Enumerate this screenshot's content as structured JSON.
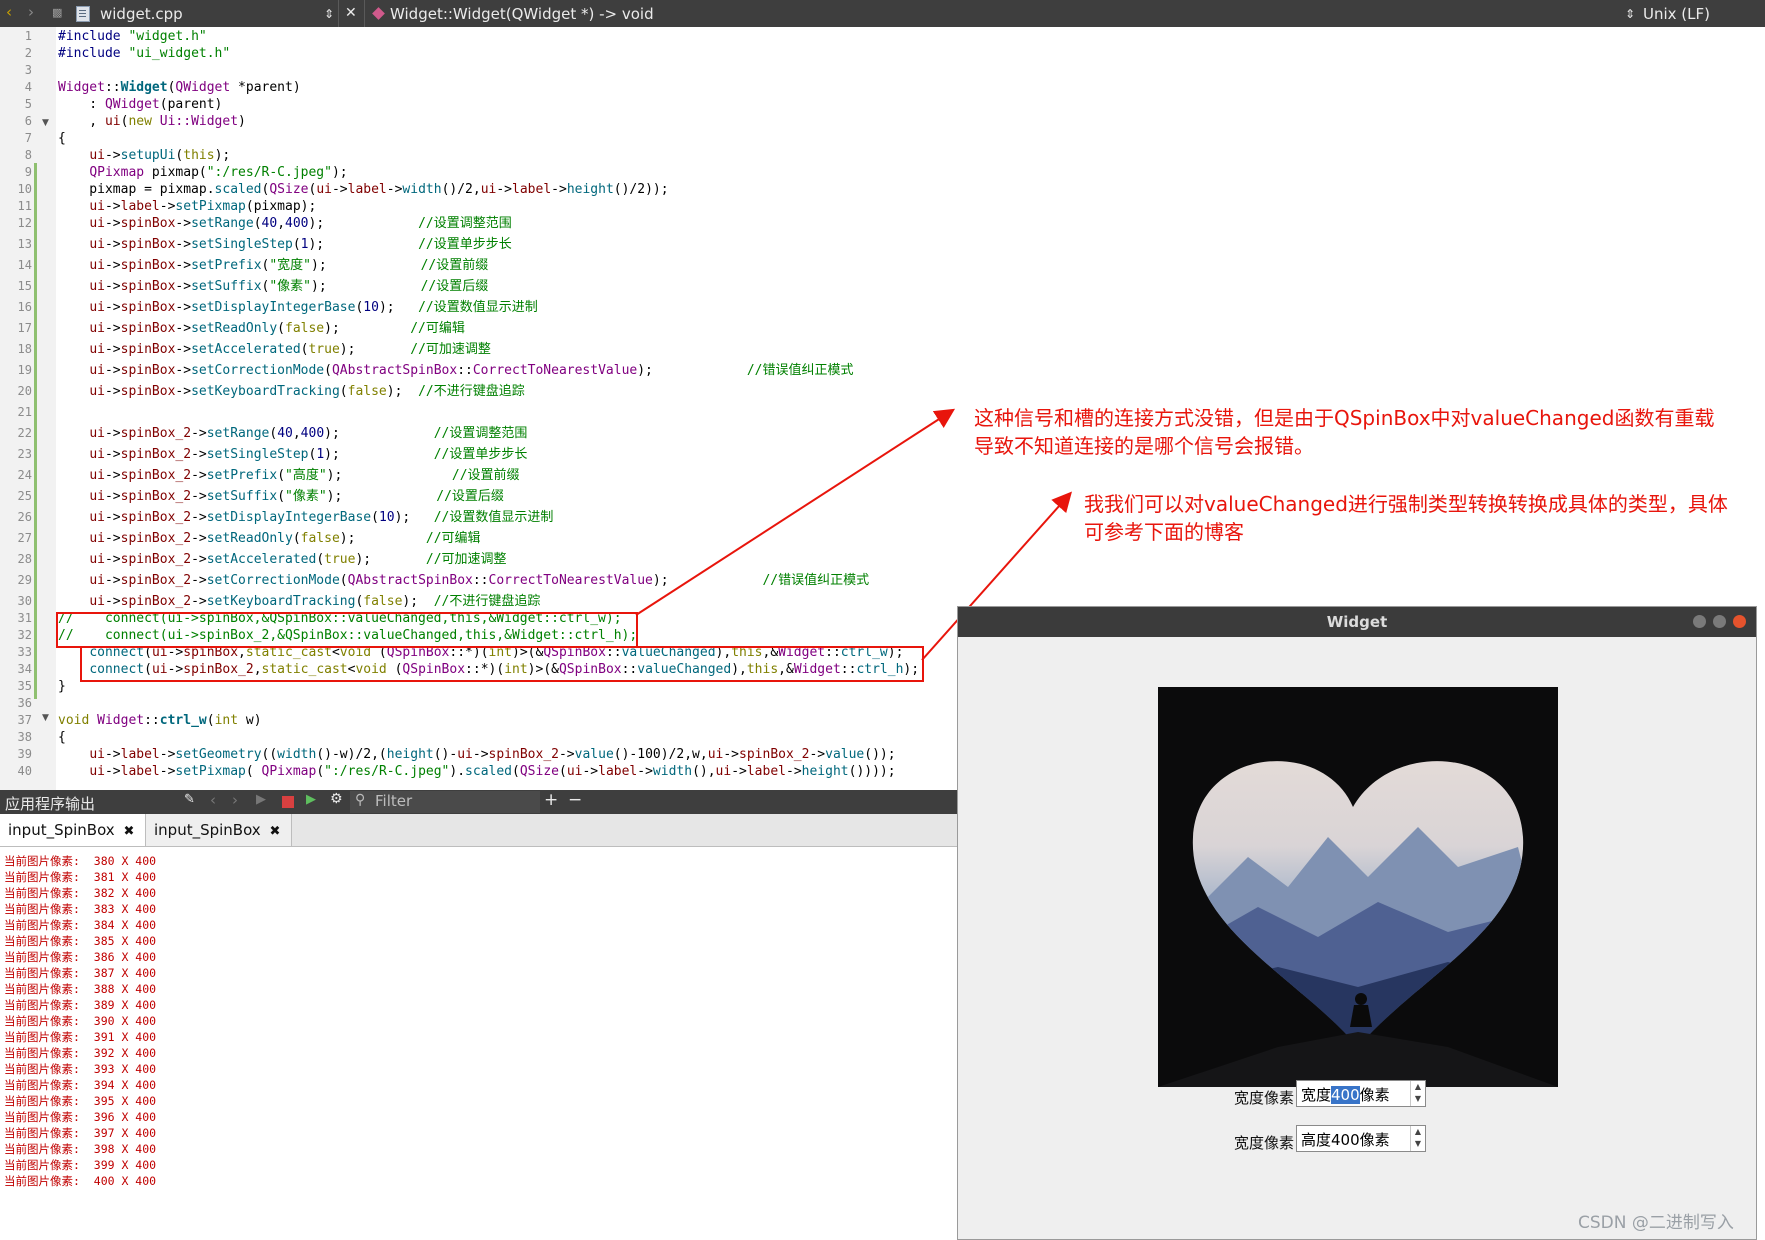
{
  "topbar": {
    "filename": "widget.cpp",
    "function": "Widget::Widget(QWidget *) -> void",
    "encoding": "Unix (LF)"
  },
  "editor": {
    "line_numbers": [
      "1",
      "2",
      "3",
      "4",
      "5",
      "6",
      "7",
      "8",
      "9",
      "10",
      "11",
      "12",
      "13",
      "14",
      "15",
      "16",
      "17",
      "18",
      "19",
      "20",
      "21",
      "22",
      "23",
      "24",
      "25",
      "26",
      "27",
      "28",
      "29",
      "30",
      "31",
      "32",
      "33",
      "34",
      "35",
      "36",
      "37",
      "38",
      "39",
      "40"
    ]
  },
  "annotations": {
    "note1_line1": "这种信号和槽的连接方式没错，但是由于QSpinBox中对valueChanged函数有重载",
    "note1_line2": "导致不知道连接的是哪个信号会报错。",
    "note2_line1": "我我们可以对valueChanged进行强制类型转换转换成具体的类型，具体",
    "note2_line2": "可参考下面的博客"
  },
  "output": {
    "title": "应用程序输出",
    "filter_placeholder": "Filter",
    "tabs": [
      "input_SpinBox",
      "input_SpinBox"
    ],
    "lines": [
      "当前图片像素:  380 X 400",
      "当前图片像素:  381 X 400",
      "当前图片像素:  382 X 400",
      "当前图片像素:  383 X 400",
      "当前图片像素:  384 X 400",
      "当前图片像素:  385 X 400",
      "当前图片像素:  386 X 400",
      "当前图片像素:  387 X 400",
      "当前图片像素:  388 X 400",
      "当前图片像素:  389 X 400",
      "当前图片像素:  390 X 400",
      "当前图片像素:  391 X 400",
      "当前图片像素:  392 X 400",
      "当前图片像素:  393 X 400",
      "当前图片像素:  394 X 400",
      "当前图片像素:  395 X 400",
      "当前图片像素:  396 X 400",
      "当前图片像素:  397 X 400",
      "当前图片像素:  398 X 400",
      "当前图片像素:  399 X 400",
      "当前图片像素:  400 X 400"
    ]
  },
  "widget_window": {
    "title": "Widget",
    "label1": "宽度像素",
    "label2": "宽度像素",
    "spin1_prefix": "宽度",
    "spin1_value": "400",
    "spin1_suffix": "像素",
    "spin2_text": "高度400像素"
  },
  "watermark": "CSDN @二进制写入",
  "colors": {
    "annotation": "#e8150c",
    "titlebar": "#3e3e3e",
    "output_text": "#c00000"
  }
}
